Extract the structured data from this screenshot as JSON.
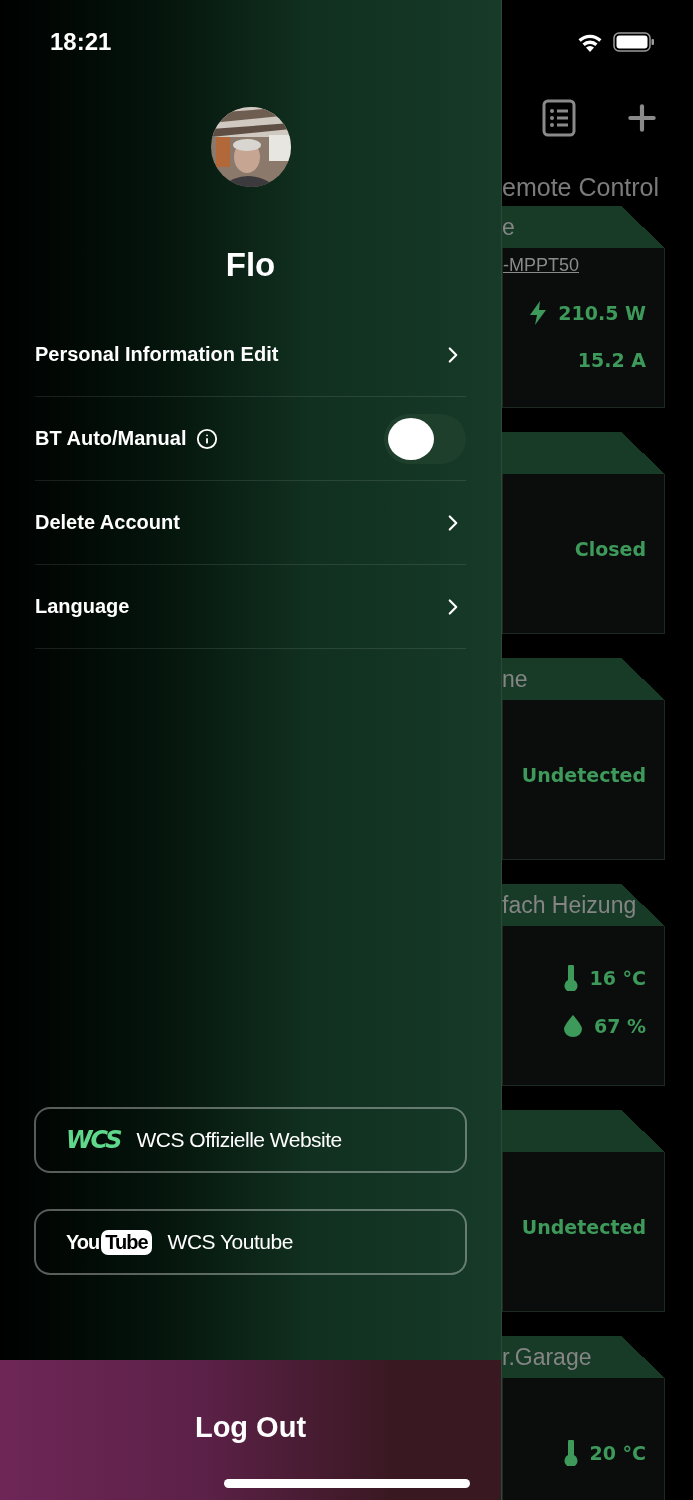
{
  "status_bar": {
    "time": "18:21"
  },
  "drawer": {
    "user_name": "Flo",
    "menu": [
      {
        "kind": "link",
        "label": "Personal Information Edit"
      },
      {
        "kind": "toggle",
        "label": "BT Auto/Manual",
        "on": false
      },
      {
        "kind": "link",
        "label": "Delete Account"
      },
      {
        "kind": "link",
        "label": "Language"
      }
    ],
    "links": [
      {
        "kind": "wcs",
        "logo": "WCS",
        "label": "WCS Offizielle Website"
      },
      {
        "kind": "youtube",
        "logo": [
          "You",
          "Tube"
        ],
        "label": "WCS Youtube"
      }
    ],
    "logout": "Log Out"
  },
  "background": {
    "tab": "emote Control",
    "cards": [
      {
        "title": "e",
        "device": "-MPPT50",
        "readings": [
          {
            "kind": "power",
            "text": "210.5 W"
          },
          {
            "kind": "plain",
            "text": "15.2 A"
          }
        ]
      },
      {
        "readings": [
          {
            "kind": "plain",
            "text": "Closed"
          }
        ]
      },
      {
        "title": "ne",
        "readings": [
          {
            "kind": "plain",
            "text": "Undetected"
          }
        ]
      },
      {
        "title": "fach Heizung",
        "readings": [
          {
            "kind": "temperature",
            "text": "16 °C"
          },
          {
            "kind": "humidity",
            "text": "67 %"
          }
        ]
      },
      {
        "readings": [
          {
            "kind": "plain",
            "text": "Undetected"
          }
        ]
      },
      {
        "title": "r.Garage",
        "readings": [
          {
            "kind": "temperature",
            "text": "20 °C"
          }
        ]
      }
    ]
  }
}
